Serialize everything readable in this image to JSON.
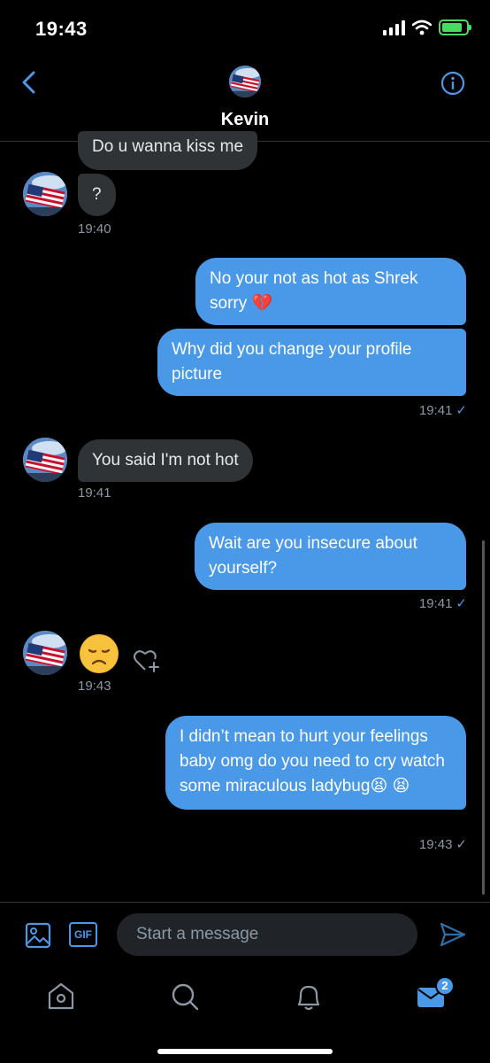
{
  "status": {
    "time": "19:43"
  },
  "header": {
    "name": "Kevin"
  },
  "messages": [
    {
      "dir": "in",
      "text": "Do u wanna kiss me"
    },
    {
      "dir": "in",
      "text": "?"
    },
    {
      "time": "19:40"
    },
    {
      "dir": "out",
      "text": "No your not as hot as Shrek sorry 💔"
    },
    {
      "dir": "out",
      "text": "Why did you change your profile picture"
    },
    {
      "time": "19:41"
    },
    {
      "dir": "in",
      "text": "You said I'm not hot"
    },
    {
      "time": "19:41"
    },
    {
      "dir": "out",
      "text": "Wait are you insecure about yourself?"
    },
    {
      "time": "19:41"
    },
    {
      "dir": "in",
      "emoji": "😞"
    },
    {
      "time": "19:43"
    },
    {
      "dir": "out",
      "text": "I didn’t mean to hurt your feelings baby omg do you need to cry watch some miraculous ladybug😫 😫"
    },
    {
      "time": "19:43"
    }
  ],
  "composer": {
    "placeholder": "Start a message",
    "gif_label": "GIF"
  },
  "tabbar": {
    "messages_badge": "2"
  },
  "colors": {
    "accent": "#4a99e9",
    "bubble_in": "#2f3336",
    "bubble_out": "#4a99e9"
  }
}
